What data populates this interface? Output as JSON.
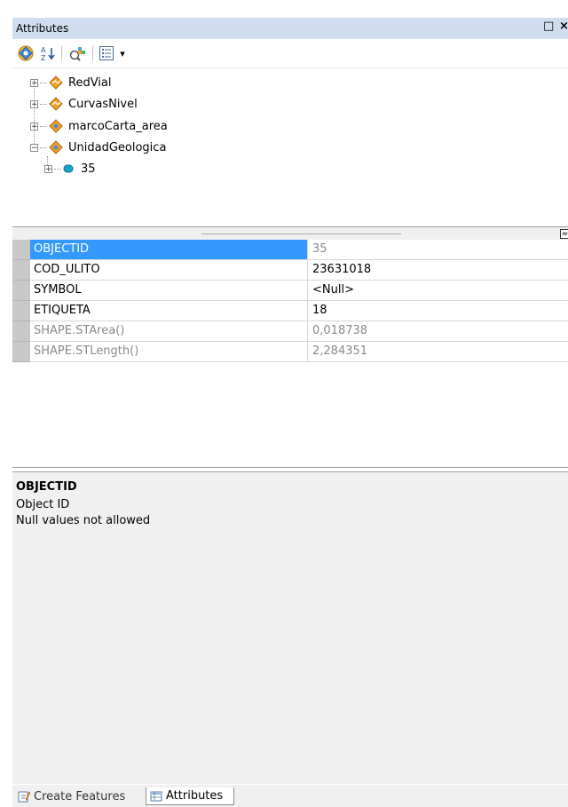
{
  "window": {
    "title": "Attributes",
    "restore_glyph": "□",
    "close_glyph": "×"
  },
  "toolbar": {
    "buttons": [
      {
        "name": "list-by-layer-icon"
      },
      {
        "name": "sort-alphabetical-icon"
      },
      {
        "name": "select-features-icon"
      },
      {
        "name": "options-menu-icon"
      }
    ],
    "dropdown_glyph": "▾"
  },
  "tree": {
    "layers": [
      {
        "label": "RedVial",
        "expander": "+"
      },
      {
        "label": "CurvasNivel",
        "expander": "+"
      },
      {
        "label": "marcoCarta_area",
        "expander": "+"
      },
      {
        "label": "UnidadGeologica",
        "expander": "−"
      }
    ],
    "feature": {
      "label": "35",
      "expander": "+"
    }
  },
  "attributes": {
    "rows": [
      {
        "name": "OBJECTID",
        "value": "35",
        "state": "selected"
      },
      {
        "name": "COD_ULITO",
        "value": "23631018",
        "state": "editable"
      },
      {
        "name": "SYMBOL",
        "value": "<Null>",
        "state": "editable"
      },
      {
        "name": "ETIQUETA",
        "value": "18",
        "state": "editable"
      },
      {
        "name": "SHAPE.STArea()",
        "value": "0,018738",
        "state": "readonly"
      },
      {
        "name": "SHAPE.STLength()",
        "value": "2,284351",
        "state": "readonly"
      }
    ]
  },
  "description": {
    "title": "OBJECTID",
    "line1": "Object ID",
    "line2": "Null values not allowed"
  },
  "tabs": {
    "create_features": "Create Features",
    "attributes": "Attributes"
  },
  "colors": {
    "selection": "#3399ff",
    "titlebar": "#cfddee",
    "layer_icon": "#f4a020",
    "feature_icon": "#1aa3c4"
  }
}
